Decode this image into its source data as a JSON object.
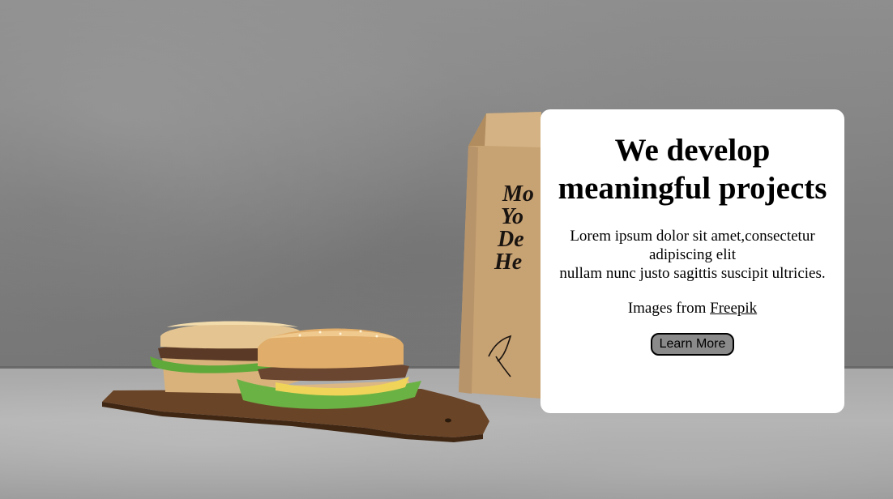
{
  "hero": {
    "background_image": "sandwiches-on-cutting-board-with-paper-bag",
    "bag_print": [
      "Mo",
      "Yo",
      "De",
      "He"
    ]
  },
  "card": {
    "title": "We develop meaningful projects",
    "description_line1": "Lorem ipsum dolor sit amet,consectetur adipiscing elit",
    "description_line2": "nullam nunc justo sagittis suscipit ultricies.",
    "credit_prefix": "Images from",
    "credit_link": "Freepik",
    "button_label": "Learn More"
  },
  "colors": {
    "card_background": "#ffffff",
    "button_background": "#8a8a8a",
    "wall": "#838383",
    "bag": "#c9a77a"
  }
}
